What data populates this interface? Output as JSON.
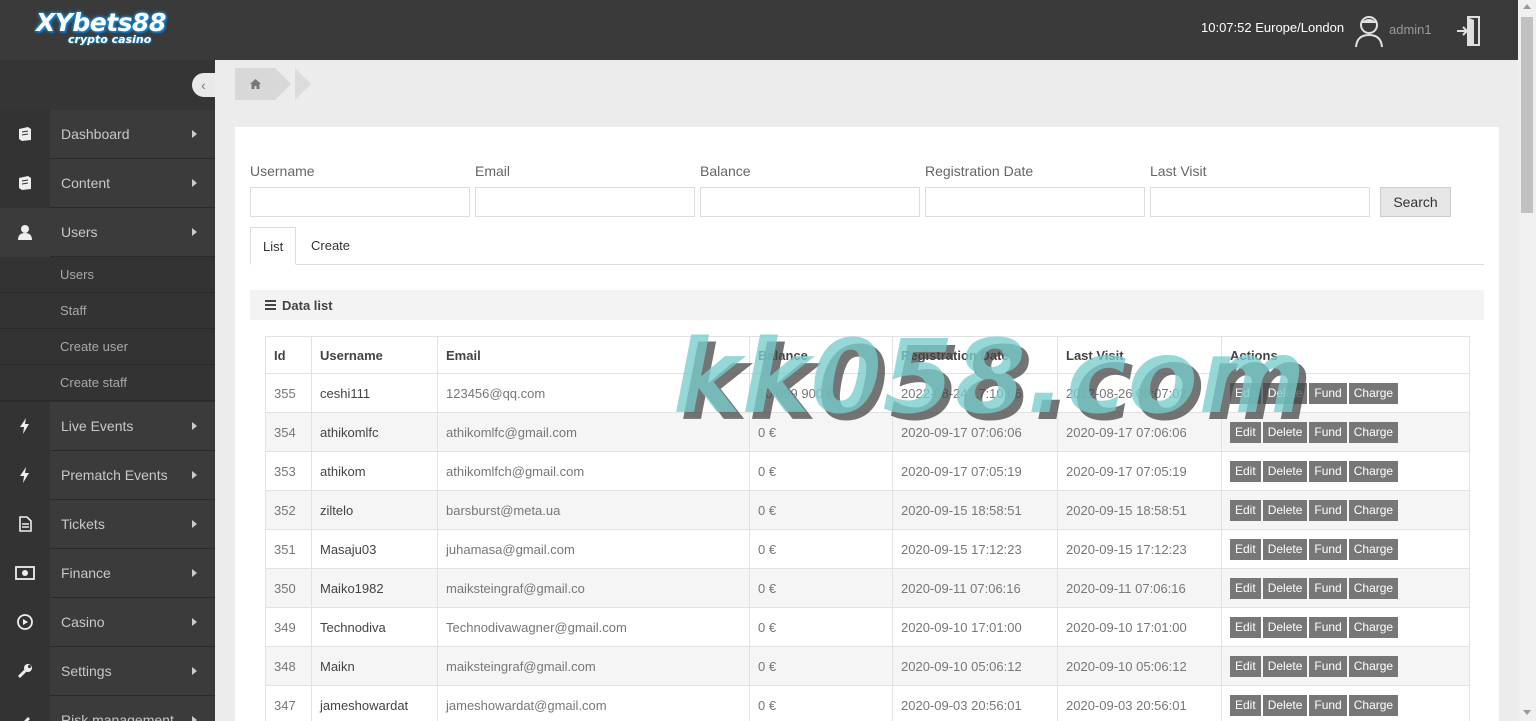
{
  "header": {
    "logo_main": "XYbets88",
    "logo_sub": "crypto casino",
    "clock": "10:07:52 Europe/London",
    "username": "admin1"
  },
  "sidebar": {
    "items": [
      {
        "label": "Dashboard",
        "icon": "book-icon"
      },
      {
        "label": "Content",
        "icon": "book-icon"
      },
      {
        "label": "Users",
        "icon": "user-icon"
      },
      {
        "label": "Live Events",
        "icon": "bolt-icon"
      },
      {
        "label": "Prematch Events",
        "icon": "bolt-icon"
      },
      {
        "label": "Tickets",
        "icon": "document-icon"
      },
      {
        "label": "Finance",
        "icon": "money-icon"
      },
      {
        "label": "Casino",
        "icon": "play-icon"
      },
      {
        "label": "Settings",
        "icon": "wrench-icon"
      },
      {
        "label": "Risk management",
        "icon": "pen-icon"
      }
    ],
    "users_submenu": [
      "Users",
      "Staff",
      "Create user",
      "Create staff"
    ]
  },
  "filters": {
    "username_label": "Username",
    "email_label": "Email",
    "balance_label": "Balance",
    "regdate_label": "Registration Date",
    "lastvisit_label": "Last Visit",
    "search_button": "Search"
  },
  "tabs": {
    "list": "List",
    "create": "Create"
  },
  "datalist_title": "Data list",
  "table": {
    "headers": [
      "Id",
      "Username",
      "Email",
      "Balance",
      "Registration Date",
      "Last Visit",
      "Actions"
    ],
    "actions": [
      "Edit",
      "Delete",
      "Fund",
      "Charge"
    ],
    "rows": [
      {
        "id": "355",
        "username": "ceshi111",
        "email": "123456@qq.com",
        "balance": "10 099 900 €",
        "reg": "2022-08-24 17:10:06",
        "visit": "2022-08-26 09:07:02"
      },
      {
        "id": "354",
        "username": "athikomlfc",
        "email": "athikomlfc@gmail.com",
        "balance": "0 €",
        "reg": "2020-09-17 07:06:06",
        "visit": "2020-09-17 07:06:06"
      },
      {
        "id": "353",
        "username": "athikom",
        "email": "athikomlfch@gmail.com",
        "balance": "0 €",
        "reg": "2020-09-17 07:05:19",
        "visit": "2020-09-17 07:05:19"
      },
      {
        "id": "352",
        "username": "ziltelo",
        "email": "barsburst@meta.ua",
        "balance": "0 €",
        "reg": "2020-09-15 18:58:51",
        "visit": "2020-09-15 18:58:51"
      },
      {
        "id": "351",
        "username": "Masaju03",
        "email": "juhamasa@gmail.com",
        "balance": "0 €",
        "reg": "2020-09-15 17:12:23",
        "visit": "2020-09-15 17:12:23"
      },
      {
        "id": "350",
        "username": "Maiko1982",
        "email": "maiksteingraf@gmail.co",
        "balance": "0 €",
        "reg": "2020-09-11 07:06:16",
        "visit": "2020-09-11 07:06:16"
      },
      {
        "id": "349",
        "username": "Technodiva",
        "email": "Technodivawagner@gmail.com",
        "balance": "0 €",
        "reg": "2020-09-10 17:01:00",
        "visit": "2020-09-10 17:01:00"
      },
      {
        "id": "348",
        "username": "Maikn",
        "email": "maiksteingraf@gmail.com",
        "balance": "0 €",
        "reg": "2020-09-10 05:06:12",
        "visit": "2020-09-10 05:06:12"
      },
      {
        "id": "347",
        "username": "jameshowardat",
        "email": "jameshowardat@gmail.com",
        "balance": "0 €",
        "reg": "2020-09-03 20:56:01",
        "visit": "2020-09-03 20:56:01"
      }
    ]
  },
  "watermark": "kk058.com"
}
